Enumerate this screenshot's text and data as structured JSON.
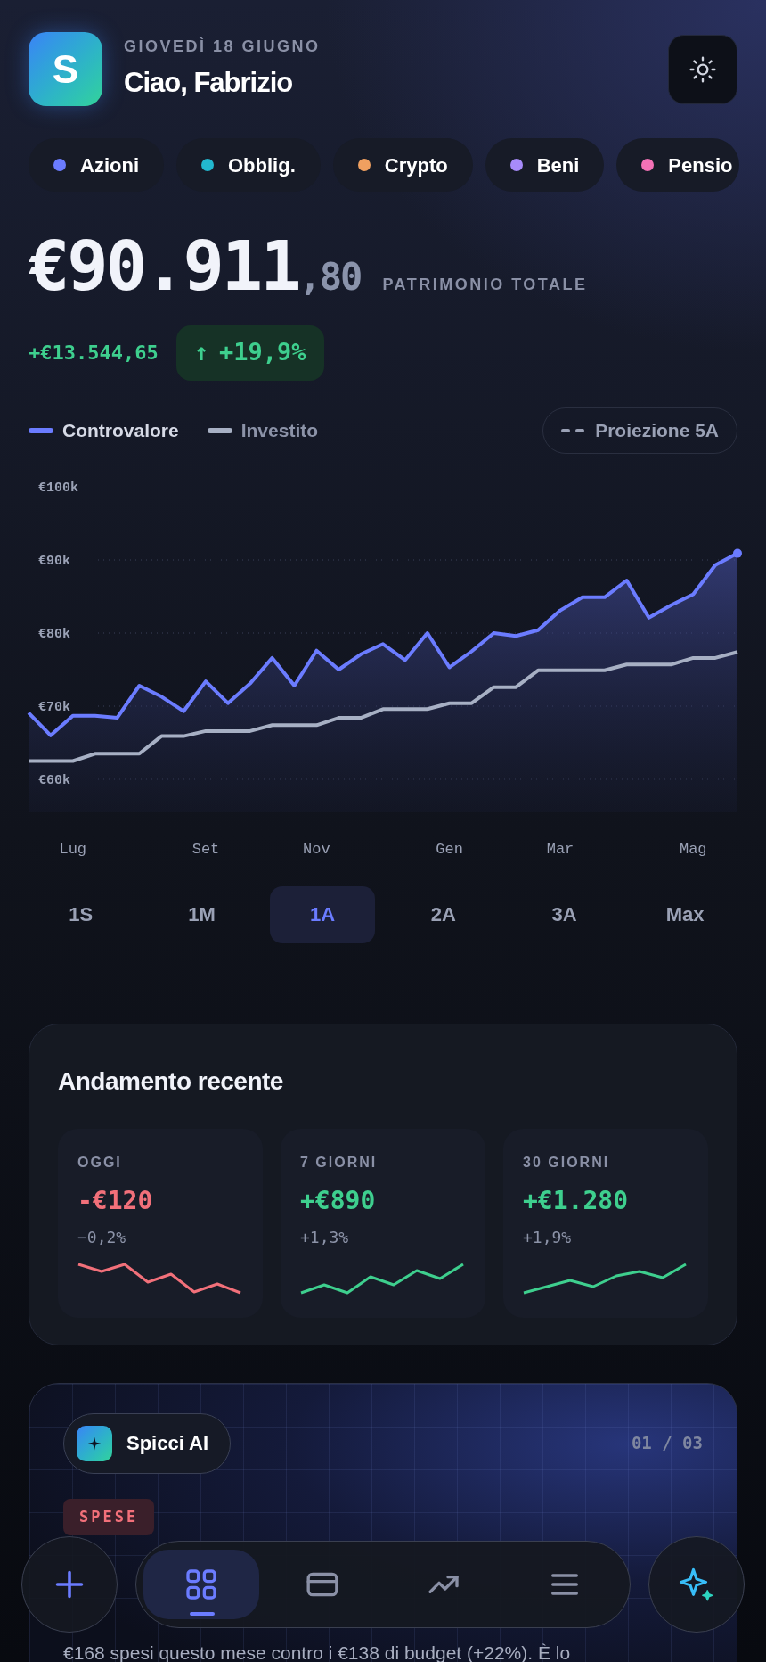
{
  "header": {
    "logo_letter": "S",
    "date": "GIOVEDÌ 18 GIUGNO",
    "greeting": "Ciao, Fabrizio"
  },
  "categories": [
    {
      "label": "Azioni",
      "color": "#6b7cff"
    },
    {
      "label": "Obblig.",
      "color": "#22b8cf"
    },
    {
      "label": "Crypto",
      "color": "#f0a060"
    },
    {
      "label": "Beni",
      "color": "#a78bfa"
    },
    {
      "label": "Pensio",
      "color": "#f472b6"
    }
  ],
  "total": {
    "integer": "€90.911",
    "decimals": ",80",
    "label": "PATRIMONIO TOTALE"
  },
  "gain": {
    "amount": "+€13.544,65",
    "arrow": "↑",
    "percent": "+19,9%"
  },
  "chart": {
    "projection_button": "Proiezione 5A",
    "chart_data": {
      "type": "area",
      "categories": [
        null,
        null,
        "Lug",
        null,
        null,
        null,
        null,
        null,
        "Set",
        null,
        null,
        null,
        null,
        "Nov",
        null,
        null,
        null,
        null,
        null,
        "Gen",
        null,
        null,
        null,
        null,
        "Mar",
        null,
        null,
        null,
        null,
        null,
        "Mag",
        null,
        null
      ],
      "series": [
        {
          "name": "Controvalore",
          "type": "area",
          "color": "#6b7cff",
          "values": [
            69.1,
            66.0,
            68.7,
            68.7,
            68.4,
            72.8,
            71.3,
            69.3,
            73.4,
            70.4,
            73.1,
            76.6,
            72.8,
            77.6,
            75.0,
            77.1,
            78.5,
            76.3,
            80.0,
            75.3,
            77.5,
            80.0,
            79.6,
            80.4,
            83.1,
            84.9,
            84.9,
            87.2,
            82.1,
            83.8,
            85.3,
            89.3,
            90.9
          ]
        },
        {
          "name": "Investito",
          "type": "line",
          "color": "#a7b0c4",
          "values": [
            62.5,
            62.5,
            62.5,
            63.5,
            63.5,
            63.5,
            65.9,
            65.9,
            66.6,
            66.6,
            66.6,
            67.4,
            67.4,
            67.4,
            68.4,
            68.4,
            69.6,
            69.6,
            69.6,
            70.4,
            70.4,
            72.6,
            72.6,
            74.9,
            74.9,
            74.9,
            74.9,
            75.7,
            75.7,
            75.7,
            76.6,
            76.6,
            77.4
          ]
        }
      ],
      "ylim": [
        60,
        100
      ],
      "grid": true,
      "yticks": [
        {
          "value": 60,
          "label": "€60k"
        },
        {
          "value": 70,
          "label": "€70k"
        },
        {
          "value": 80,
          "label": "€80k"
        },
        {
          "value": 90,
          "label": "€90k"
        },
        {
          "value": 100,
          "label": "€100k"
        }
      ]
    }
  },
  "periods": [
    {
      "label": "1S",
      "selected": false
    },
    {
      "label": "1M",
      "selected": false
    },
    {
      "label": "1A",
      "selected": true
    },
    {
      "label": "2A",
      "selected": false
    },
    {
      "label": "3A",
      "selected": false
    },
    {
      "label": "Max",
      "selected": false
    }
  ],
  "recent": {
    "title": "Andamento recente",
    "items": [
      {
        "label": "OGGI",
        "value": "-€120",
        "percent": "−0,2%",
        "color": "#f2707a"
      },
      {
        "label": "7 GIORNI",
        "value": "+€890",
        "percent": "+1,3%",
        "color": "#3ecf8e"
      },
      {
        "label": "30 GIORNI",
        "value": "+€1.280",
        "percent": "+1,9%",
        "color": "#3ecf8e"
      }
    ]
  },
  "insight": {
    "badge": "Spicci AI",
    "counter": "01 / 03",
    "tag": "SPESE",
    "text": "€168 spesi questo mese contro i €138 di budget (+22%). È lo"
  },
  "bottom_nav": {
    "items": [
      {
        "selected": true
      },
      {
        "selected": false
      },
      {
        "selected": false
      },
      {
        "selected": false
      }
    ]
  }
}
